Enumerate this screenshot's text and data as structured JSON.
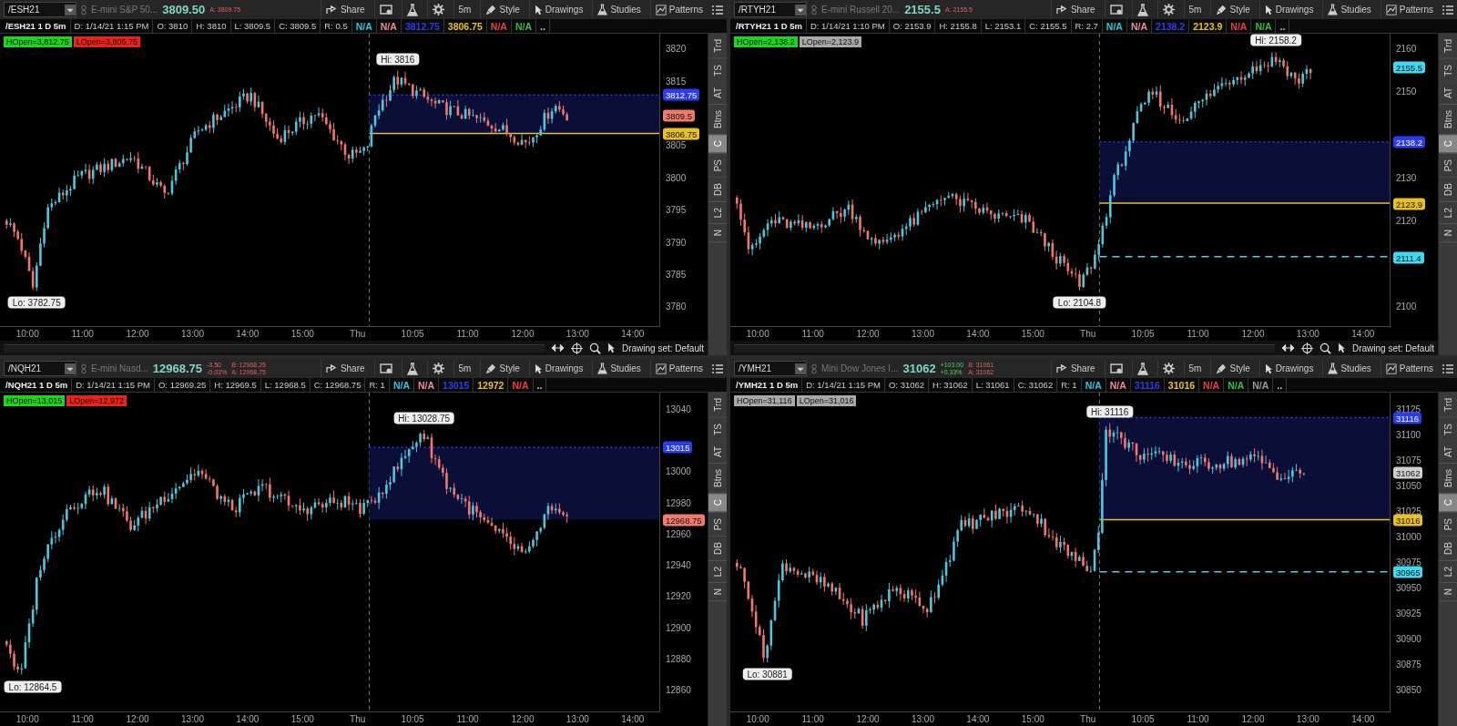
{
  "panels": [
    {
      "symbol": "/ESH21",
      "description": "E-mini S&P 50...",
      "last": "3809.50",
      "ask": "A: 3809.75",
      "buttons": [
        "Share",
        "5m",
        "Style",
        "Drawings",
        "Studies",
        "Patterns"
      ],
      "title": "/ESH21 1 D 5m",
      "fields": [
        "D: 1/14/21 1:15 PM",
        "O: 3810",
        "H: 3810",
        "L: 3809.5",
        "C: 3809.5",
        "R: 0.5"
      ],
      "studies": [
        {
          "text": "N/A",
          "color": "#2ec4e6"
        },
        {
          "text": "N/A",
          "color": "#f08a9a"
        },
        {
          "text": "3812.75",
          "color": "#2a3cf0"
        },
        {
          "text": "3806.75",
          "color": "#e8c020"
        },
        {
          "text": "N/A",
          "color": "#e84040"
        },
        {
          "text": "N/A",
          "color": "#30c040"
        }
      ],
      "more": "..",
      "badges": [
        {
          "text": "HOpen=3,812.75",
          "color": "#1ed41e"
        },
        {
          "text": "LOpen=3,806.75",
          "color": "#e8241a"
        }
      ],
      "y_axis": [
        "3820",
        "3815",
        "3805",
        "3800",
        "3795",
        "3790",
        "3785",
        "3780"
      ],
      "tags": [
        {
          "text": "3812.75",
          "color": "#2a3cf0",
          "kind": "dotted"
        },
        {
          "text": "3809.5",
          "color": "#f07a6e",
          "kind": "last"
        },
        {
          "text": "3806.75",
          "color": "#e8c020",
          "kind": "solid"
        }
      ],
      "hi": "Hi: 3816",
      "lo": "Lo: 3782.75",
      "x_axis": [
        "10:00",
        "11:00",
        "12:00",
        "13:00",
        "14:00",
        "15:00",
        "Thu",
        "10:05",
        "11:00",
        "12:00",
        "13:00",
        "14:00"
      ],
      "drawing_set": "Drawing set: Default",
      "side_tabs": [
        {
          "label": "Trd",
          "selected": false
        },
        {
          "label": "TS",
          "selected": false
        },
        {
          "label": "AT",
          "selected": false
        },
        {
          "label": "Btns",
          "selected": false
        },
        {
          "label": "C",
          "selected": true
        },
        {
          "label": "PS",
          "selected": false
        },
        {
          "label": "DB",
          "selected": false
        },
        {
          "label": "L2",
          "selected": false
        },
        {
          "label": "N",
          "selected": false
        }
      ]
    },
    {
      "symbol": "/RTYH21",
      "description": "E-mini Russell 20...",
      "last": "2155.5",
      "ask": "A: 2155.5",
      "buttons": [
        "Share",
        "5m",
        "Style",
        "Drawings",
        "Studies",
        "Patterns"
      ],
      "title": "/RTYH21 1 D 5m",
      "fields": [
        "D: 1/14/21 1:10 PM",
        "O: 2153.9",
        "H: 2155.8",
        "L: 2153.1",
        "C: 2155.5",
        "R: 2.7"
      ],
      "studies": [
        {
          "text": "N/A",
          "color": "#2ec4e6"
        },
        {
          "text": "N/A",
          "color": "#f08a9a"
        },
        {
          "text": "2138.2",
          "color": "#2a3cf0"
        },
        {
          "text": "2123.9",
          "color": "#e8c020"
        },
        {
          "text": "N/A",
          "color": "#e84040"
        },
        {
          "text": "N/A",
          "color": "#30c040"
        }
      ],
      "more": "..",
      "badges": [
        {
          "text": "HOpen=2,138.2",
          "color": "#1ed41e"
        },
        {
          "text": "LOpen=2,123.9",
          "color": "#a8a8a8"
        }
      ],
      "y_axis": [
        "2160",
        "2150",
        "2130",
        "2120",
        "2100"
      ],
      "tags": [
        {
          "text": "2155.5",
          "color": "#3fd8f0",
          "kind": "last"
        },
        {
          "text": "2138.2",
          "color": "#2a3cf0",
          "kind": "dotted"
        },
        {
          "text": "2123.9",
          "color": "#e8c020",
          "kind": "solid"
        },
        {
          "text": "2111.4",
          "color": "#3fd8f0",
          "kind": "dashed"
        }
      ],
      "hi": "Hi: 2158.2",
      "lo": "Lo: 2104.8",
      "x_axis": [
        "10:00",
        "11:00",
        "12:00",
        "13:00",
        "14:00",
        "15:00",
        "Thu",
        "10:05",
        "11:00",
        "12:00",
        "13:00",
        "14:00"
      ],
      "drawing_set": "Drawing set: Default",
      "side_tabs": [
        {
          "label": "Trd",
          "selected": false
        },
        {
          "label": "TS",
          "selected": false
        },
        {
          "label": "AT",
          "selected": false
        },
        {
          "label": "Btns",
          "selected": false
        },
        {
          "label": "C",
          "selected": true
        },
        {
          "label": "PS",
          "selected": false
        },
        {
          "label": "DB",
          "selected": false
        },
        {
          "label": "L2",
          "selected": false
        },
        {
          "label": "N",
          "selected": false
        }
      ]
    },
    {
      "symbol": "/NQH21",
      "description": "E-mini Nasd...",
      "last": "12968.75",
      "change": "-3.50",
      "change_percent": "-0.03%",
      "bid": "B: 12968.25",
      "ask": "A: 12968.75",
      "buttons": [
        "Share",
        "5m",
        "Style",
        "Drawings",
        "Studies",
        "Patterns"
      ],
      "title": "/NQH21 1 D 5m",
      "fields": [
        "D: 1/14/21 1:15 PM",
        "O: 12969.25",
        "H: 12969.5",
        "L: 12968.5",
        "C: 12968.75",
        "R: 1"
      ],
      "studies": [
        {
          "text": "N/A",
          "color": "#2ec4e6"
        },
        {
          "text": "N/A",
          "color": "#f08a9a"
        },
        {
          "text": "13015",
          "color": "#2a3cf0"
        },
        {
          "text": "12972",
          "color": "#e8c020"
        },
        {
          "text": "N/A",
          "color": "#e84040"
        }
      ],
      "more": "..",
      "badges": [
        {
          "text": "HOpen=13,015",
          "color": "#1ed41e"
        },
        {
          "text": "LOpen=12,972",
          "color": "#e8241a"
        }
      ],
      "y_axis": [
        "13040",
        "13000",
        "12980",
        "12960",
        "12940",
        "12920",
        "12900",
        "12880",
        "12860"
      ],
      "tags": [
        {
          "text": "13015",
          "color": "#2a3cf0",
          "kind": "dotted"
        },
        {
          "text": "12968.75",
          "color": "#f07a6e",
          "kind": "last"
        }
      ],
      "hi": "Hi: 13028.75",
      "lo": "Lo: 12864.5",
      "x_axis": [
        "10:00",
        "11:00",
        "12:00",
        "13:00",
        "14:00",
        "15:00",
        "Thu",
        "10:05",
        "11:00",
        "12:00",
        "13:00",
        "14:00"
      ],
      "side_tabs": [
        {
          "label": "Trd",
          "selected": false
        },
        {
          "label": "TS",
          "selected": false
        },
        {
          "label": "AT",
          "selected": false
        },
        {
          "label": "Btns",
          "selected": false
        },
        {
          "label": "C",
          "selected": true
        },
        {
          "label": "PS",
          "selected": false
        },
        {
          "label": "DB",
          "selected": false
        },
        {
          "label": "L2",
          "selected": false
        },
        {
          "label": "N",
          "selected": false
        }
      ]
    },
    {
      "symbol": "/YMH21",
      "description": "Mini Dow Jones I...",
      "last": "31062",
      "change": "+103.00",
      "change_percent": "+0.33%",
      "bid": "B: 31061",
      "ask": "A: 31062",
      "buttons": [
        "Share",
        "5m",
        "Style",
        "Drawings",
        "Studies",
        "Patterns"
      ],
      "title": "/YMH21 1 D 5m",
      "fields": [
        "D: 1/14/21 1:15 PM",
        "O: 31062",
        "H: 31062",
        "L: 31061",
        "C: 31062",
        "R: 1"
      ],
      "studies": [
        {
          "text": "N/A",
          "color": "#2ec4e6"
        },
        {
          "text": "N/A",
          "color": "#f08a9a"
        },
        {
          "text": "31116",
          "color": "#2a3cf0"
        },
        {
          "text": "31016",
          "color": "#e8c020"
        },
        {
          "text": "N/A",
          "color": "#e84040"
        },
        {
          "text": "N/A",
          "color": "#30c040"
        },
        {
          "text": "N/A",
          "color": "#9a9a9a"
        }
      ],
      "more": "..",
      "badges": [
        {
          "text": "HOpen=31,116",
          "color": "#a8a8a8"
        },
        {
          "text": "LOpen=31,016",
          "color": "#a8a8a8"
        }
      ],
      "y_axis": [
        "31125",
        "31100",
        "31075",
        "31050",
        "31025",
        "31000",
        "30975",
        "30950",
        "30925",
        "30900",
        "30875",
        "30850"
      ],
      "tags": [
        {
          "text": "31116",
          "color": "#2a3cf0",
          "kind": "dotted"
        },
        {
          "text": "31062",
          "color": "#d0d0d0",
          "kind": "last"
        },
        {
          "text": "31016",
          "color": "#e8c020",
          "kind": "solid"
        },
        {
          "text": "30965",
          "color": "#3fd8f0",
          "kind": "dashed"
        }
      ],
      "hi": "Hi: 31116",
      "lo": "Lo: 30881",
      "x_axis": [
        "10:00",
        "11:00",
        "12:00",
        "13:00",
        "14:00",
        "15:00",
        "Thu",
        "10:05",
        "11:00",
        "12:00",
        "13:00",
        "14:00"
      ],
      "side_tabs": [
        {
          "label": "Trd",
          "selected": false
        },
        {
          "label": "TS",
          "selected": false
        },
        {
          "label": "AT",
          "selected": false
        },
        {
          "label": "Btns",
          "selected": false
        },
        {
          "label": "C",
          "selected": true
        },
        {
          "label": "PS",
          "selected": false
        },
        {
          "label": "DB",
          "selected": false
        },
        {
          "label": "L2",
          "selected": false
        },
        {
          "label": "N",
          "selected": false
        }
      ]
    }
  ]
}
